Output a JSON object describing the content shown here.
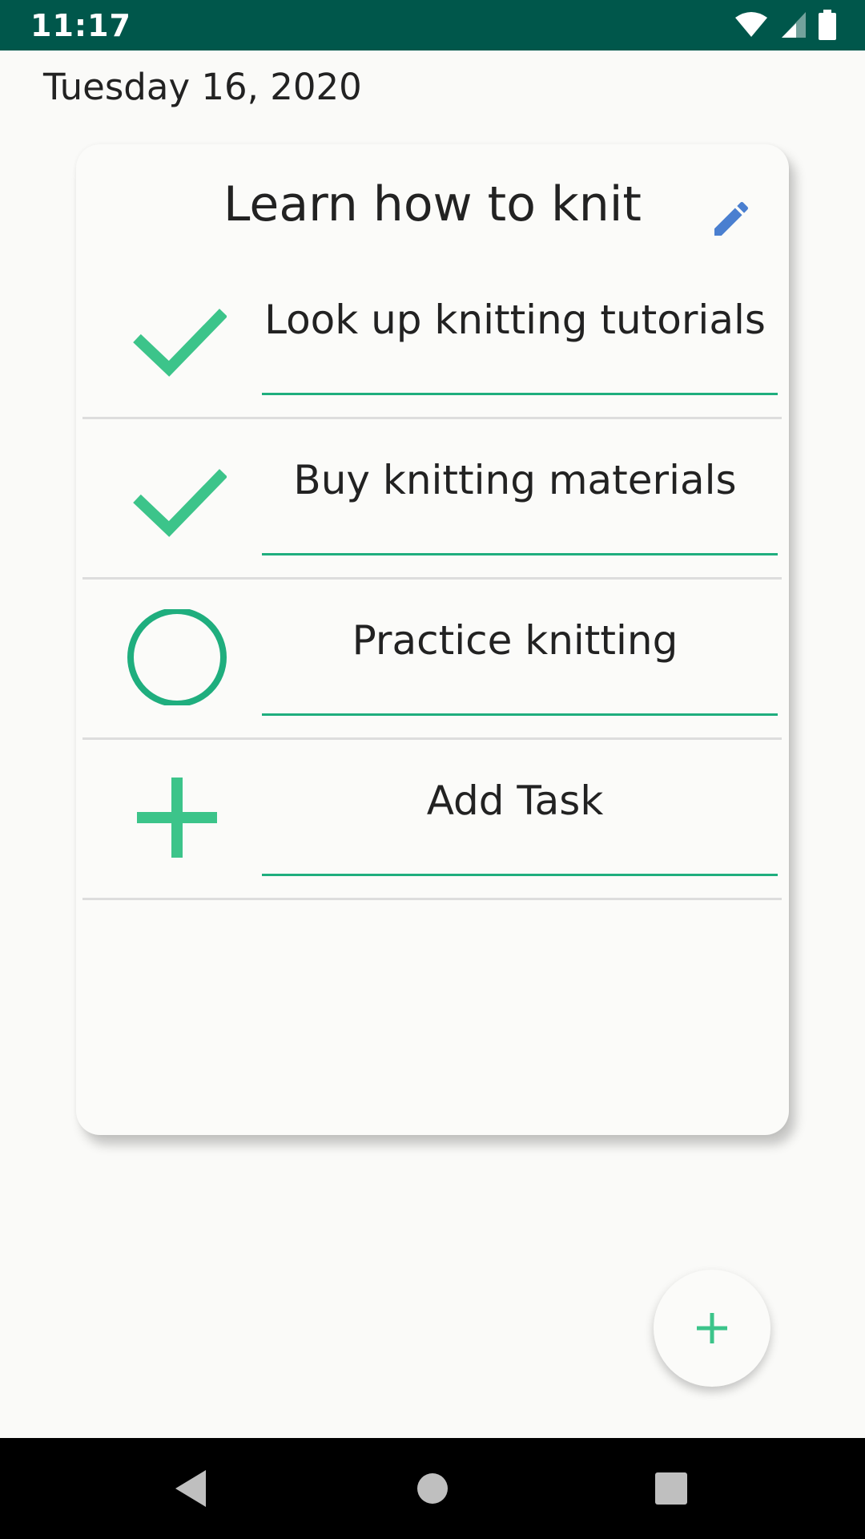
{
  "status_bar": {
    "time": "11:17",
    "icons": [
      "wifi-icon",
      "signal-icon",
      "battery-icon"
    ],
    "background": "#00574b"
  },
  "header": {
    "date": "Tuesday 16, 2020"
  },
  "card": {
    "title": "Learn how to knit",
    "edit_icon": "pencil-icon",
    "tasks": [
      {
        "label": "Look up knitting tutorials",
        "status": "done",
        "icon": "checkmark-icon"
      },
      {
        "label": "Buy knitting materials",
        "status": "done",
        "icon": "checkmark-icon"
      },
      {
        "label": "Practice knitting",
        "status": "pending",
        "icon": "circle-icon"
      },
      {
        "label": "Add Task",
        "status": "add",
        "icon": "plus-icon"
      }
    ]
  },
  "fab": {
    "icon": "plus-icon"
  },
  "nav_bar": {
    "buttons": [
      "back-icon",
      "home-icon",
      "recents-icon"
    ]
  },
  "colors": {
    "accent_green": "#3cc48a",
    "pencil_blue": "#4a7fd0",
    "underline_green": "#1fae7e"
  }
}
